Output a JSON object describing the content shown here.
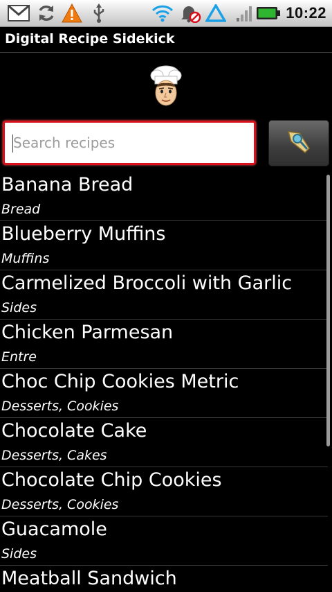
{
  "status_bar": {
    "time": "10:22",
    "icons": [
      "gmail-icon",
      "sync-icon",
      "warning-icon",
      "usb-icon",
      "wifi-icon",
      "alarm-muted-icon",
      "data-triangle-icon",
      "signal-icon",
      "battery-icon"
    ]
  },
  "app": {
    "title": "Digital Recipe Sidekick"
  },
  "search": {
    "placeholder": "Search recipes",
    "value": ""
  },
  "recipes": [
    {
      "name": "Banana Bread",
      "category": "Bread"
    },
    {
      "name": "Blueberry Muffins",
      "category": "Muffins"
    },
    {
      "name": "Carmelized Broccoli with Garlic",
      "category": "Sides"
    },
    {
      "name": "Chicken Parmesan",
      "category": "Entre"
    },
    {
      "name": "Choc Chip Cookies Metric",
      "category": "Desserts, Cookies"
    },
    {
      "name": "Chocolate Cake",
      "category": "Desserts, Cakes"
    },
    {
      "name": "Chocolate Chip Cookies",
      "category": "Desserts, Cookies"
    },
    {
      "name": "Guacamole",
      "category": "Sides"
    },
    {
      "name": "Meatball Sandwich",
      "category": ""
    }
  ],
  "colors": {
    "search_border": "#d8101c",
    "battery": "#2fb52f",
    "wifi": "#1aa1e8",
    "warning": "#f07a12"
  }
}
